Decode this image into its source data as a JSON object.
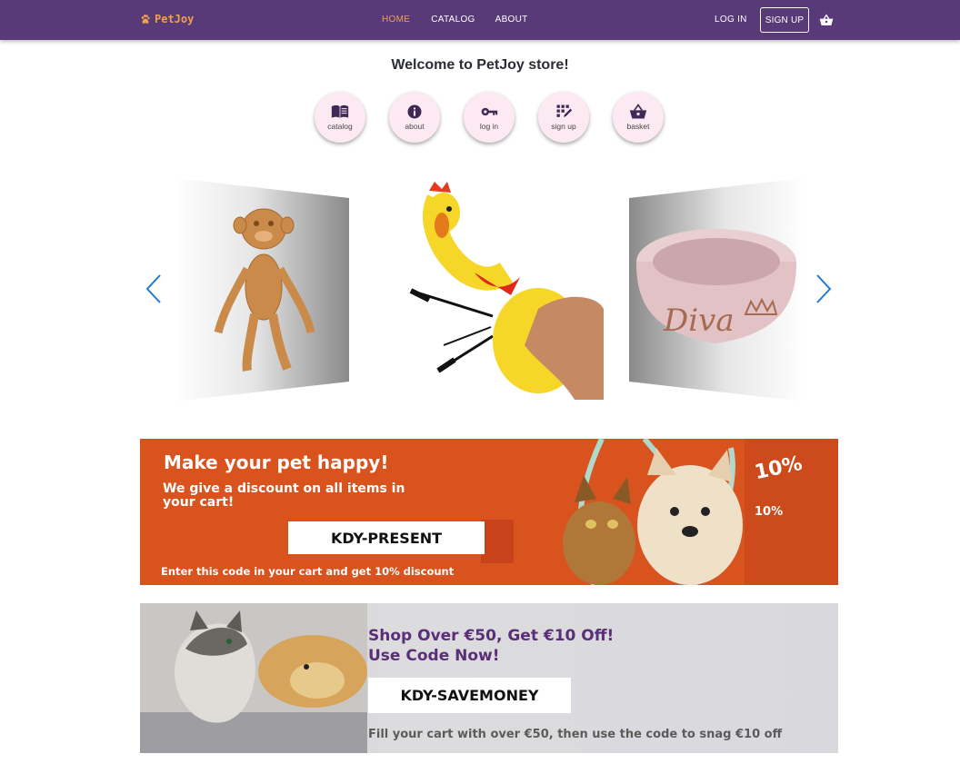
{
  "brand": {
    "name": "PetJoy",
    "icon": "paw-icon",
    "color": "#f0a14c"
  },
  "nav": {
    "links": [
      {
        "label": "HOME",
        "active": true
      },
      {
        "label": "CATALOG",
        "active": false
      },
      {
        "label": "ABOUT",
        "active": false
      }
    ],
    "login_label": "LOG IN",
    "signup_label": "SIGN UP",
    "cart_icon": "basket-icon",
    "bar_color": "#583a78"
  },
  "welcome": "Welcome to PetJoy store!",
  "quick_links": [
    {
      "label": "catalog",
      "icon": "book-icon"
    },
    {
      "label": "about",
      "icon": "info-icon"
    },
    {
      "label": "log in",
      "icon": "key-icon"
    },
    {
      "label": "sign up",
      "icon": "dialpad-icon"
    },
    {
      "label": "basket",
      "icon": "basket-icon"
    }
  ],
  "carousel": {
    "prev_icon": "chevron-left-icon",
    "next_icon": "chevron-right-icon",
    "slides": [
      "monkey-toy",
      "rubber-chicken-toy",
      "pet-bowl"
    ],
    "bowl_text": "Diva"
  },
  "promo1": {
    "title": "Make your pet happy!",
    "subtitle": "We give a discount on all items in your cart!",
    "code": "KDY-PRESENT",
    "note": "Enter this code in your cart and get 10% discount",
    "badge_large": "10%",
    "badge_small": "10%",
    "bg_color": "#d9531f"
  },
  "promo2": {
    "title_line1": "Shop Over €50, Get €10 Off!",
    "title_line2": "Use Code Now!",
    "code": "KDY-SAVEMONEY",
    "note": "Fill your cart with over €50, then use the code to snag €10 off",
    "title_color": "#5a2f78"
  }
}
